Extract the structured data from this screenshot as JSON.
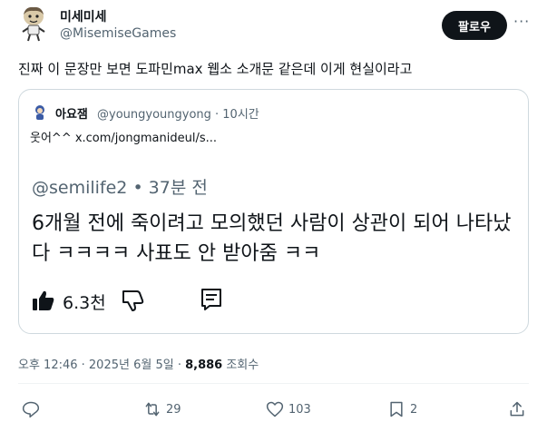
{
  "author": {
    "display_name": "미세미세",
    "handle": "@MisemiseGames",
    "avatar": "cartoon-character-avatar"
  },
  "follow_label": "팔로우",
  "more_label": "···",
  "tweet_text": "진짜 이 문장만 보면 도파민max 웹소 소개문 같은데 이게 현실이라고",
  "quote": {
    "author_name": "아요잼",
    "author_handle": "@youngyoungyong · 10시간",
    "text": "웃어^^  x.com/jongmanideul/s...",
    "image": {
      "handle": "@semilife2 • 37분 전",
      "line1": "6개월 전에 죽이려고 모의했던 사람이 상관이 되어 나타났",
      "line2": "다 ㅋㅋㅋㅋ 사표도 안 받아줌 ㅋㅋ",
      "like_count": "6.3천"
    }
  },
  "meta": {
    "timestamp": "오후 12:46 · 2025년 6월 5일 · ",
    "views_count": "8,886",
    "views_label": " 조회수"
  },
  "actions": {
    "reply_count": "",
    "retweet_count": "29",
    "like_count": "103",
    "bookmark_count": "2"
  }
}
